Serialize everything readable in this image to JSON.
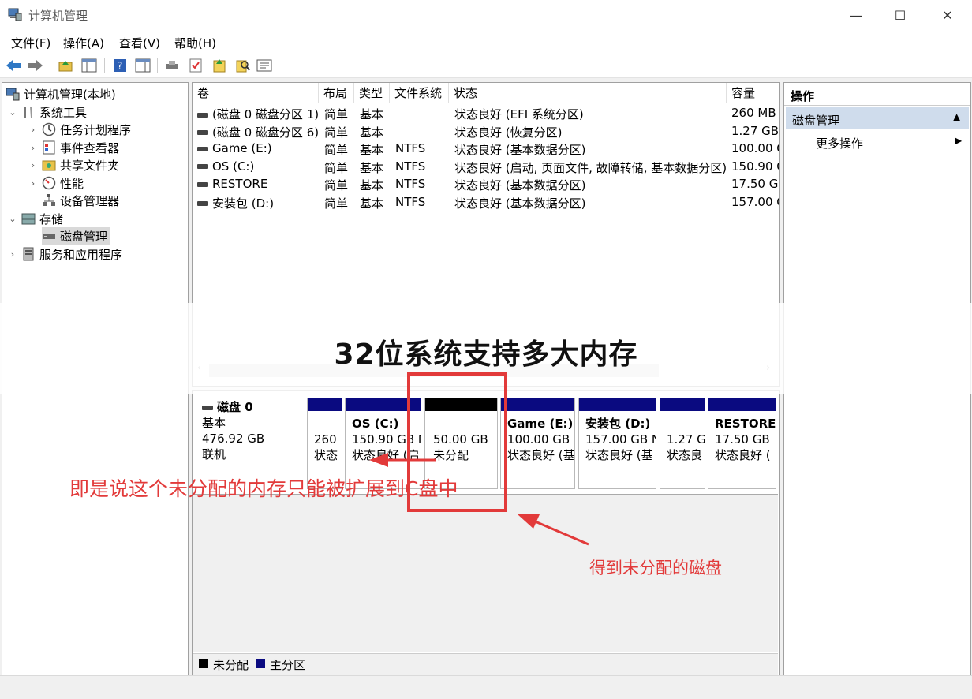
{
  "window": {
    "title": "计算机管理",
    "minimize": "—",
    "maximize": "☐",
    "close": "✕"
  },
  "menu": [
    {
      "label": "文件(F)"
    },
    {
      "label": "操作(A)"
    },
    {
      "label": "查看(V)"
    },
    {
      "label": "帮助(H)"
    }
  ],
  "toolbar_icons": [
    "back-icon",
    "forward-icon",
    "up-folder-icon",
    "show-hide-tree-icon",
    "help-icon",
    "properties-icon",
    "disk-icon",
    "check-icon",
    "import-icon",
    "search-icon",
    "properties-list-icon"
  ],
  "tree": {
    "root": "计算机管理(本地)",
    "system_tools": "系统工具",
    "task_scheduler": "任务计划程序",
    "event_viewer": "事件查看器",
    "shared_folders": "共享文件夹",
    "performance": "性能",
    "device_manager": "设备管理器",
    "storage": "存储",
    "disk_management": "磁盘管理",
    "services_apps": "服务和应用程序"
  },
  "volumes": {
    "headers": {
      "volume": "卷",
      "layout": "布局",
      "type": "类型",
      "fs": "文件系统",
      "status": "状态",
      "capacity": "容量"
    },
    "rows": [
      {
        "volume": "(磁盘 0 磁盘分区 1)",
        "layout": "简单",
        "type": "基本",
        "fs": "",
        "status": "状态良好 (EFI 系统分区)",
        "capacity": "260 MB"
      },
      {
        "volume": "(磁盘 0 磁盘分区 6)",
        "layout": "简单",
        "type": "基本",
        "fs": "",
        "status": "状态良好 (恢复分区)",
        "capacity": "1.27 GB"
      },
      {
        "volume": "Game (E:)",
        "layout": "简单",
        "type": "基本",
        "fs": "NTFS",
        "status": "状态良好 (基本数据分区)",
        "capacity": "100.00 G"
      },
      {
        "volume": "OS (C:)",
        "layout": "简单",
        "type": "基本",
        "fs": "NTFS",
        "status": "状态良好 (启动, 页面文件, 故障转储, 基本数据分区)",
        "capacity": "150.90 G"
      },
      {
        "volume": "RESTORE",
        "layout": "简单",
        "type": "基本",
        "fs": "NTFS",
        "status": "状态良好 (基本数据分区)",
        "capacity": "17.50 GB"
      },
      {
        "volume": "安装包 (D:)",
        "layout": "简单",
        "type": "基本",
        "fs": "NTFS",
        "status": "状态良好 (基本数据分区)",
        "capacity": "157.00 G"
      }
    ]
  },
  "disk": {
    "name": "磁盘 0",
    "type": "基本",
    "size": "476.92 GB",
    "state": "联机",
    "partitions": [
      {
        "title": "",
        "line1": "260",
        "line2": "状态"
      },
      {
        "title": "OS  (C:)",
        "line1": "150.90 GB N",
        "line2": "状态良好 (启"
      },
      {
        "title": "",
        "line1": "50.00 GB",
        "line2": "未分配"
      },
      {
        "title": "Game  (E:)",
        "line1": "100.00 GB I",
        "line2": "状态良好 (基"
      },
      {
        "title": "安装包  (D:)",
        "line1": "157.00 GB N",
        "line2": "状态良好 (基"
      },
      {
        "title": "",
        "line1": "1.27 G",
        "line2": "状态良"
      },
      {
        "title": "RESTORE",
        "line1": "17.50 GB",
        "line2": "状态良好 ("
      }
    ]
  },
  "legend": {
    "unallocated": "未分配",
    "primary": "主分区"
  },
  "actions": {
    "header": "操作",
    "section": "磁盘管理",
    "more": "更多操作"
  },
  "overlay": {
    "banner": "32位系统支持多大内存",
    "note1": "即是说这个未分配的内存只能被扩展到C盘中",
    "note2": "得到未分配的磁盘"
  },
  "colors": {
    "accent_red": "#e23a3a",
    "partition_bar": "#0a0a80",
    "unallocated": "#000000",
    "selection": "#cce4f7"
  }
}
